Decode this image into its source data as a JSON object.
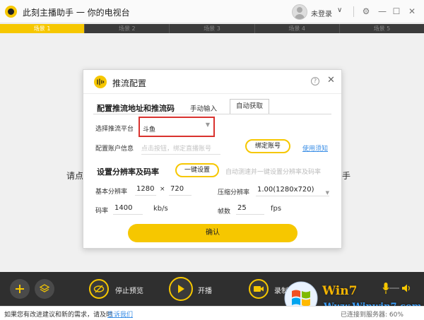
{
  "app": {
    "title": "此刻主播助手 一 你的电视台",
    "user_name": "未登录",
    "user_chevron": "∨",
    "controls": {
      "settings": "⚙",
      "minimize": "—",
      "maximize": "☐",
      "close": "✕"
    }
  },
  "scenes": {
    "tabs": [
      "场景 1",
      "场景 2",
      "场景 3",
      "场景 4",
      "场景 5"
    ],
    "active_index": 0
  },
  "background": {
    "hint_left": "请点",
    "hint_right": "手"
  },
  "dialog": {
    "title": "推流配置",
    "help": "?",
    "close": "✕",
    "stream": {
      "section_title": "配置推流地址和推流码",
      "tab_manual": "手动输入",
      "tab_auto": "自动获取",
      "platform_label": "选择推流平台",
      "platform_value": "斗鱼",
      "platform_arrow": "▼",
      "account_label": "配置账户信息",
      "account_hint": "点击按钮，绑定直播账号",
      "bind_button": "绑定账号",
      "help_link": "使用须知"
    },
    "resolution": {
      "section_title": "设置分辨率及码率",
      "auto_button": "一键设置",
      "auto_hint": "自动测速并一键设置分辨率及码率",
      "base_label": "基本分辨率",
      "base_width": "1280",
      "times": "×",
      "base_height": "720",
      "scaled_label": "压缩分辨率",
      "scaled_value": "1.00(1280x720)",
      "bitrate_label": "码率",
      "bitrate_value": "1400",
      "bitrate_unit": "kb/s",
      "fps_label": "帧数",
      "fps_value": "25",
      "fps_unit": "fps"
    },
    "confirm": "确认"
  },
  "toolbar": {
    "stop_preview": "停止预览",
    "start_stream": "开播",
    "record": "录制"
  },
  "watermark": {
    "brand": "Win7",
    "url": "Www.Winwin7.com"
  },
  "status": {
    "text": "如果您有改进建议和新的需求，请及时",
    "link": "告诉我们",
    "right": "已连接到服务器: 60%"
  },
  "colors": {
    "accent": "#f6c700",
    "highlight_border": "#d9322e",
    "link": "#3a8ee6",
    "toolbar_bg": "#2f2f2f"
  }
}
